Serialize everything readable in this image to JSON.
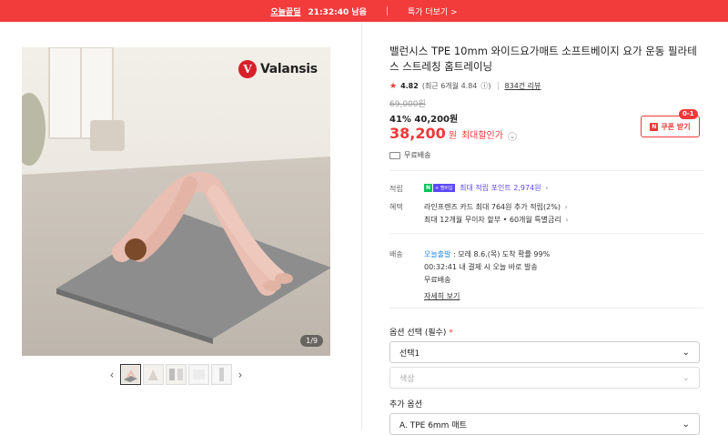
{
  "banner": {
    "brand": "오늘끝딜",
    "time": "21:32:40 남음",
    "more": "특가 더보기 >"
  },
  "gallery": {
    "logo_text": "Valansis",
    "logo_mark": "V",
    "pager": "1/9",
    "thumbnails": 5
  },
  "product": {
    "title": "밸런시스 TPE 10mm 와이드요가매트 소프트베이지 요가 운동 필라테스 스트레칭 홈트레이닝",
    "rating_score": "4.82",
    "rating_recent": "(최근 6개월 4.84",
    "rating_info": "ⓘ)",
    "review_count": "834건 리뷰",
    "original_price": "69,000원",
    "discount_line": "41% 40,200원",
    "sale_price": "38,200",
    "sale_unit": "원",
    "max_discount": "최대할인가",
    "coupon_label": "쿠폰 받기",
    "coupon_badge": "0-1",
    "free_shipping": "무료배송"
  },
  "benefits": {
    "point_label": "적립",
    "point_badge_n": "N",
    "point_badge_plus": "+ 멤버십",
    "point_text": "최대 적립 포인트 2,974원",
    "benefit_label": "혜택",
    "benefit_1": "라인프렌즈 카드 최대 764원 추가 적립(2%)",
    "benefit_2": "최대 12개월 무이자 할부 • 60개월 특별금리"
  },
  "delivery": {
    "label": "배송",
    "today": "오늘출발",
    "eta": " : 모레 8.6.(목) 도착 확률 99%",
    "countdown": "00:32:41  내 결제 시 오늘 바로 발송",
    "free": "무료배송",
    "details": "자세히 보기"
  },
  "options": {
    "title": "옵션 선택 (필수)",
    "required_mark": "*",
    "select_1": "선택1",
    "select_2": "색상",
    "extra_title": "추가 옵션",
    "extra_select": "A. TPE 6mm 매트"
  },
  "colors": {
    "accent": "#f03838",
    "point": "#5b49f5",
    "naver_green": "#03c75a",
    "today_blue": "#1e88e5"
  }
}
